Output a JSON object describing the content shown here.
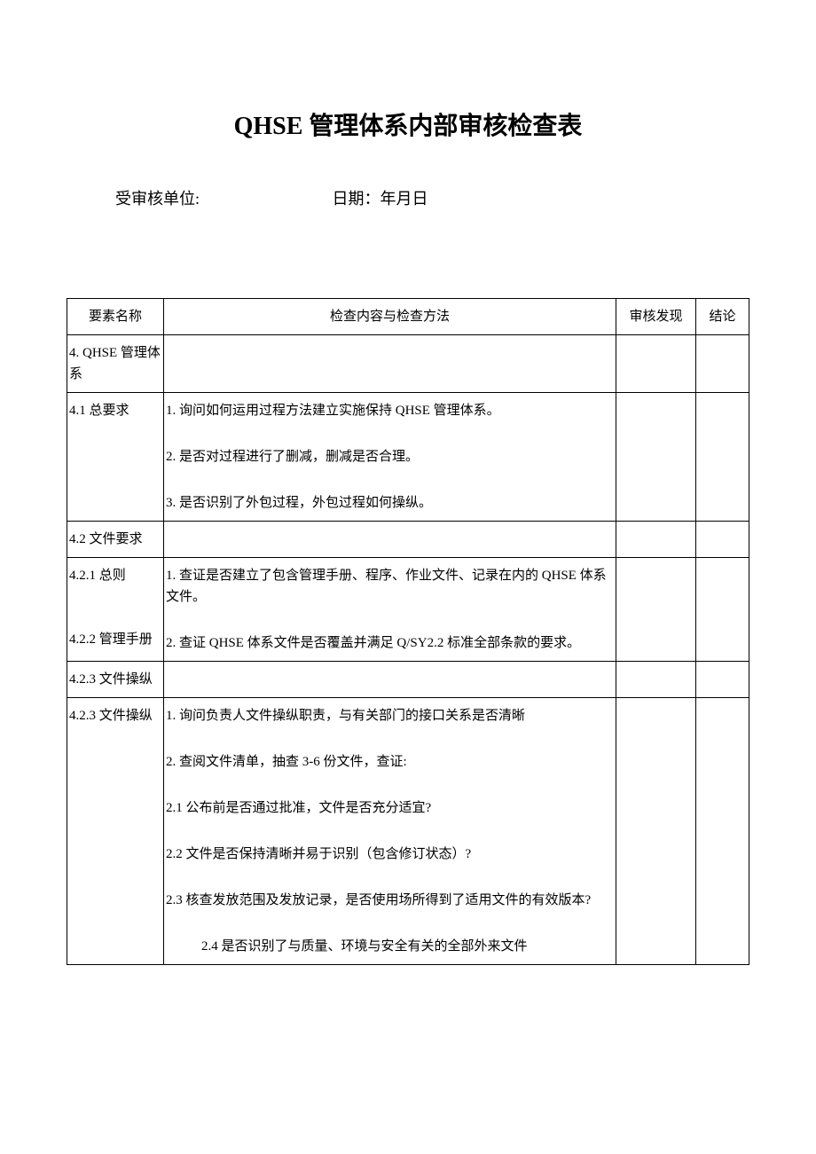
{
  "title": "QHSE 管理体系内部审核检查表",
  "meta": {
    "unit_label": "受审核单位:",
    "date_label": "日期：年月日"
  },
  "headers": {
    "element": "要素名称",
    "content": "检查内容与检查方法",
    "finding": "审核发现",
    "conclusion": "结论"
  },
  "rows": {
    "r1_element": "4. QHSE 管理体系",
    "r2_element": "4.1 总要求",
    "r2_c1": "1. 询问如何运用过程方法建立实施保持 QHSE 管理体系。",
    "r2_c2": "2. 是否对过程进行了删减，删减是否合理。",
    "r2_c3": "3. 是否识别了外包过程，外包过程如何操纵。",
    "r3_element": "4.2 文件要求",
    "r4_element_a": "4.2.1 总则",
    "r4_element_b": "4.2.2 管理手册",
    "r4_c1": "1. 查证是否建立了包含管理手册、程序、作业文件、记录在内的 QHSE 体系文件。",
    "r4_c2": "2. 查证 QHSE 体系文件是否覆盖并满足 Q/SY2.2 标准全部条款的要求。",
    "r5_element": "4.2.3 文件操纵",
    "r6_element": "4.2.3 文件操纵",
    "r6_c1": "1. 询问负责人文件操纵职责，与有关部门的接口关系是否清晰",
    "r6_c2": "2. 查阅文件清单，抽查 3-6 份文件，查证:",
    "r6_c3": "2.1  公布前是否通过批准，文件是否充分适宜?",
    "r6_c4": "2.2 文件是否保持清晰并易于识别（包含修订状态）?",
    "r6_c5": "2.3 核查发放范围及发放记录，是否使用场所得到了适用文件的有效版本?",
    "r6_c6": "2.4 是否识别了与质量、环境与安全有关的全部外来文件"
  }
}
